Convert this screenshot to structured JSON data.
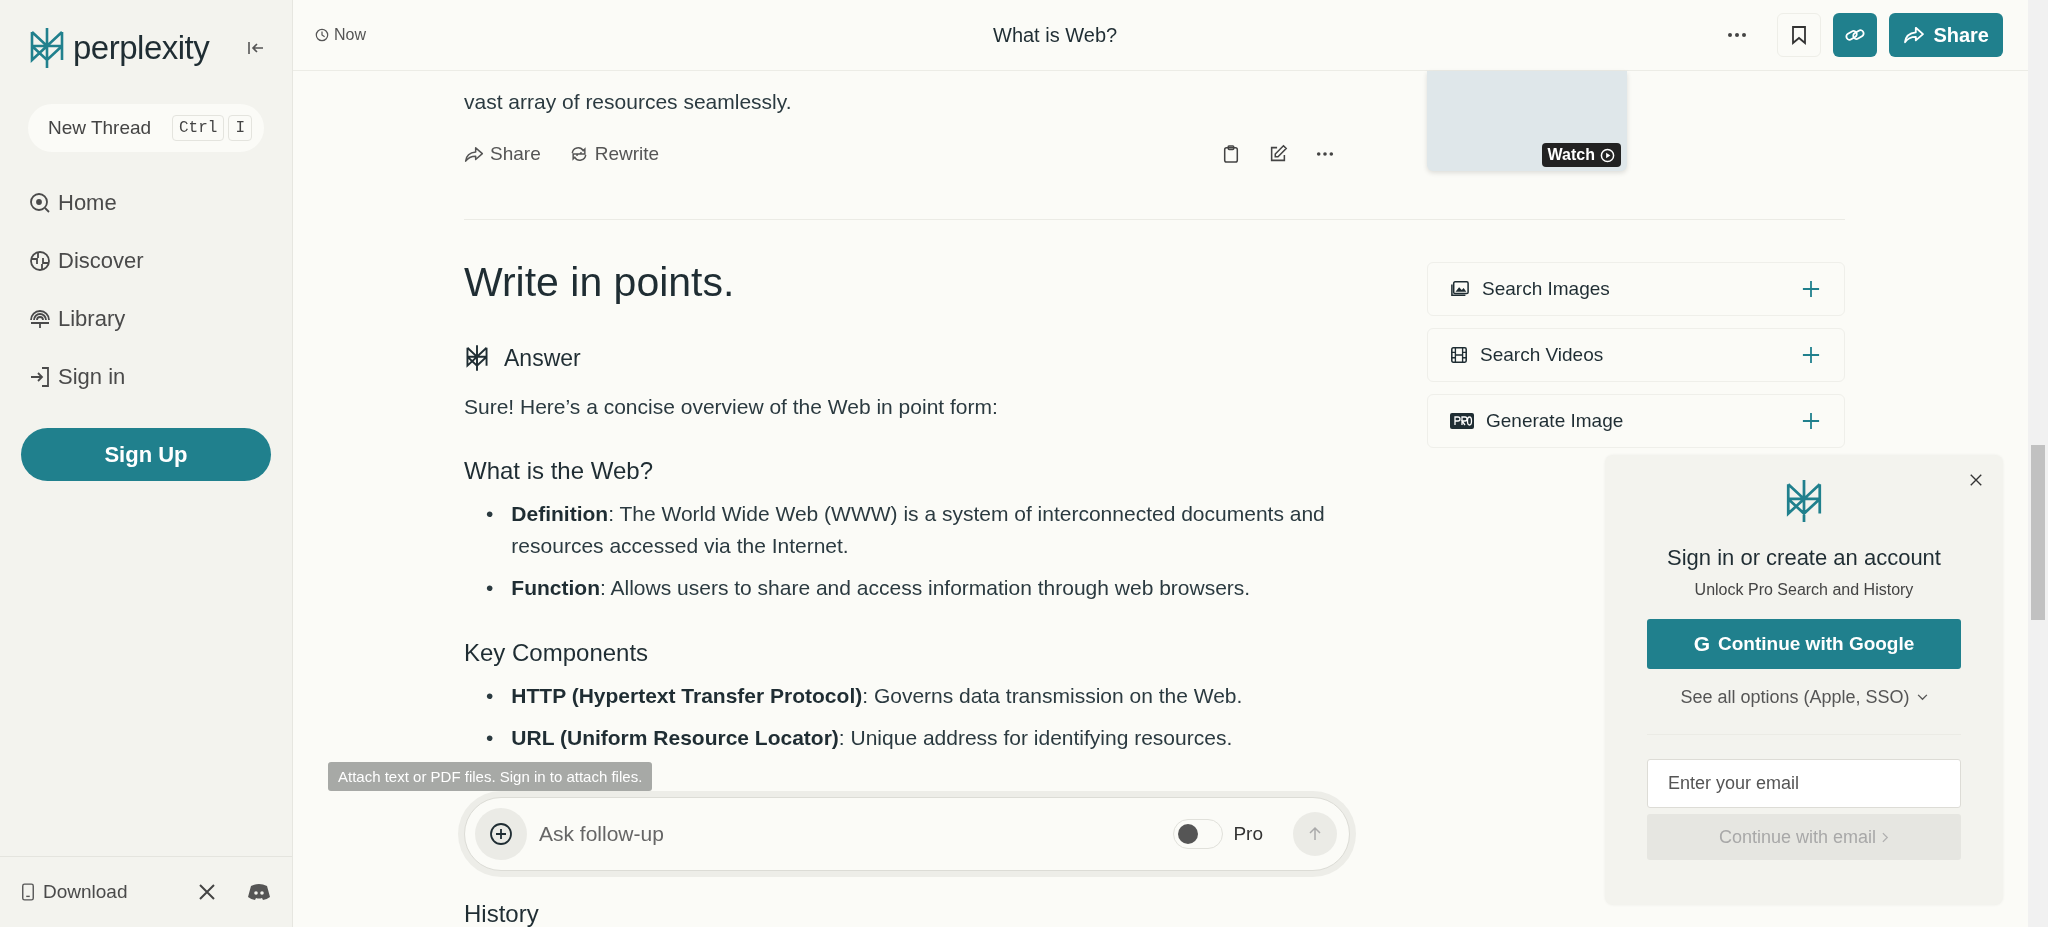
{
  "sidebar": {
    "brand": "perplexity",
    "new_thread": {
      "label": "New Thread",
      "keys": [
        "Ctrl",
        "I"
      ]
    },
    "nav": [
      {
        "label": "Home",
        "kind": "home"
      },
      {
        "label": "Discover",
        "kind": "discover"
      },
      {
        "label": "Library",
        "kind": "library"
      },
      {
        "label": "Sign in",
        "kind": "signin"
      }
    ],
    "sign_up": "Sign Up",
    "download": "Download"
  },
  "header": {
    "time": "Now",
    "title": "What is Web?",
    "share": "Share"
  },
  "previous_answer": {
    "text": "vast array of resources seamlessly.",
    "actions": [
      {
        "label": "Share",
        "kind": "share"
      },
      {
        "label": "Rewrite",
        "kind": "rewrite"
      }
    ]
  },
  "video": {
    "badge": "Watch"
  },
  "thread": {
    "query": "Write in points.",
    "answer_label": "Answer",
    "intro": "Sure! Here’s a concise overview of the Web in point form:",
    "sections": [
      {
        "heading": "What is the Web?",
        "points": [
          {
            "marker": "•",
            "text": "**Definition**: The World Wide Web (WWW) is a system of interconnected documents and resources accessed via the Internet."
          },
          {
            "marker": "•",
            "text": "**Function**: Allows users to share and access information through web browsers."
          }
        ]
      },
      {
        "heading": "Key Components",
        "points": [
          {
            "marker": "•",
            "text": "**HTTP (Hypertext Transfer Protocol)**: Governs data transmission on the Web."
          },
          {
            "marker": "•",
            "text": "**URL (Uniform Resource Locator)**: Unique address for identifying resources."
          }
        ]
      }
    ]
  },
  "composer": {
    "tooltip": "Attach text or PDF files. Sign in to attach files.",
    "placeholder": "Ask follow-up",
    "pro_label": "Pro",
    "pro_on": false
  },
  "history_heading": "History",
  "tools": [
    {
      "label": "Search Images",
      "kind": "images"
    },
    {
      "label": "Search Videos",
      "kind": "videos"
    },
    {
      "label": "Generate Image",
      "kind": "pro"
    }
  ],
  "signin": {
    "title": "Sign in or create an account",
    "subtitle": "Unlock Pro Search and History",
    "google_glyph": "G",
    "google": "Continue with Google",
    "options": "See all options (Apple, SSO)",
    "email_placeholder": "Enter your email",
    "email_button": "Continue with email"
  }
}
